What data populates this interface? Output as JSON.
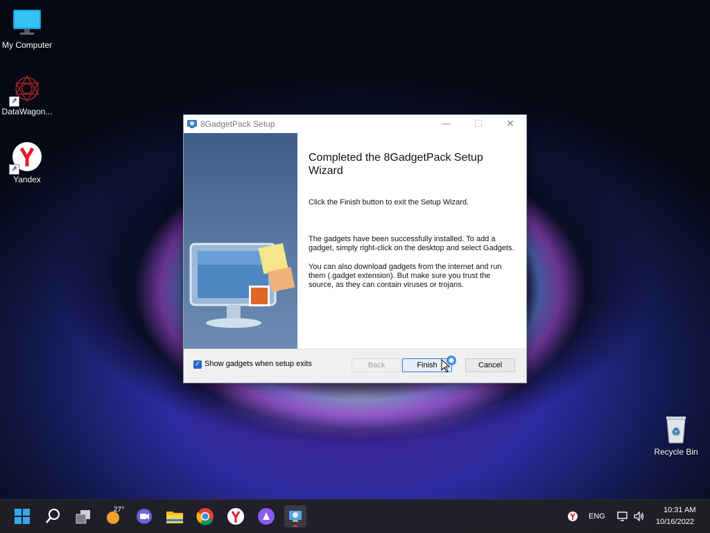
{
  "desktop": {
    "icons": [
      {
        "label": "My Computer"
      },
      {
        "label": "DataWagon..."
      },
      {
        "label": "Yandex"
      },
      {
        "label": "Recycle Bin"
      }
    ]
  },
  "dialog": {
    "title": "8GadgetPack Setup",
    "heading": "Completed the 8GadgetPack Setup Wizard",
    "para1": "Click the Finish button to exit the Setup Wizard.",
    "para2": "The gadgets have been successfully installed. To add a gadget, simply right-click on the desktop and select Gadgets.",
    "para3": "You can also download gadgets from the internet and run them (.gadget extension). But make sure you trust the source, as they can contain viruses or trojans.",
    "checkbox_label": "Show gadgets when setup exits",
    "checkbox_checked": true,
    "back_label": "Back",
    "finish_label": "Finish",
    "cancel_label": "Cancel",
    "minimize_glyph": "—",
    "maximize_glyph": "☐",
    "close_glyph": "✕"
  },
  "taskbar": {
    "weather_temp": "27°",
    "language": "ENG",
    "time": "10:31 AM",
    "date": "10/16/2022",
    "items": [
      "start-icon",
      "search-icon",
      "task-view-icon",
      "weather-icon",
      "meet-icon",
      "file-explorer-icon",
      "chrome-icon",
      "yandex-icon",
      "alice-icon",
      "setup-app-icon"
    ]
  },
  "colors": {
    "accent": "#2566c6",
    "dialog_sidebar": "#4f6f98"
  }
}
